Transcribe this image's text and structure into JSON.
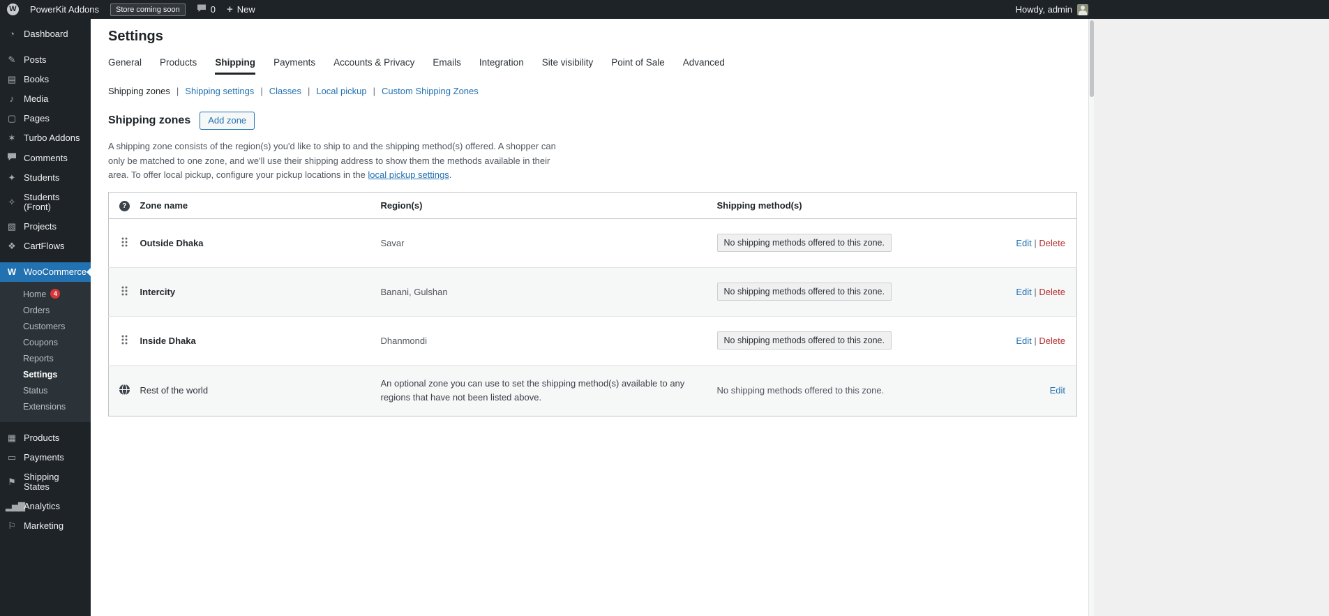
{
  "admin_bar": {
    "wp_logo_glyph": "W",
    "site_name": "PowerKit Addons",
    "coming_soon": "Store coming soon",
    "comments_count": "0",
    "new_plus": "+",
    "new_label": "New",
    "howdy": "Howdy, admin"
  },
  "sidebar": {
    "items": [
      {
        "label": "Dashboard",
        "glyph": "◔"
      },
      {
        "label": "Posts",
        "glyph": "✎"
      },
      {
        "label": "Books",
        "glyph": "▤"
      },
      {
        "label": "Media",
        "glyph": "♪"
      },
      {
        "label": "Pages",
        "glyph": "▢"
      },
      {
        "label": "Turbo Addons",
        "glyph": "✶"
      },
      {
        "label": "Comments",
        "glyph": ""
      },
      {
        "label": "Students",
        "glyph": "✦"
      },
      {
        "label": "Students (Front)",
        "glyph": "✧"
      },
      {
        "label": "Projects",
        "glyph": "▧"
      },
      {
        "label": "CartFlows",
        "glyph": "❖"
      }
    ],
    "woocommerce_label": "WooCommerce",
    "woo_glyph": "W",
    "submenu": [
      {
        "label": "Home",
        "badge": "4"
      },
      {
        "label": "Orders"
      },
      {
        "label": "Customers"
      },
      {
        "label": "Coupons"
      },
      {
        "label": "Reports"
      },
      {
        "label": "Settings"
      },
      {
        "label": "Status"
      },
      {
        "label": "Extensions"
      }
    ],
    "bottom_items": [
      {
        "label": "Products",
        "glyph": "▦"
      },
      {
        "label": "Payments",
        "glyph": "▭"
      },
      {
        "label": "Shipping States",
        "glyph": "⚑"
      },
      {
        "label": "Analytics",
        "glyph": "▂▅▇"
      },
      {
        "label": "Marketing",
        "glyph": "⚐"
      }
    ]
  },
  "page": {
    "title": "Settings",
    "tabs": [
      "General",
      "Products",
      "Shipping",
      "Payments",
      "Accounts & Privacy",
      "Emails",
      "Integration",
      "Site visibility",
      "Point of Sale",
      "Advanced"
    ],
    "active_tab": "Shipping",
    "subnav": [
      "Shipping zones",
      "Shipping settings",
      "Classes",
      "Local pickup",
      "Custom Shipping Zones"
    ],
    "subnav_separator": "|",
    "section_title": "Shipping zones",
    "add_zone_button": "Add zone",
    "description_before_link": "A shipping zone consists of the region(s) you'd like to ship to and the shipping method(s) offered. A shopper can only be matched to one zone, and we'll use their shipping address to show them the methods available in their area. To offer local pickup, configure your pickup locations in the ",
    "description_link": "local pickup settings",
    "description_after_link": "."
  },
  "table": {
    "help_icon": "?",
    "headers": [
      "Zone name",
      "Region(s)",
      "Shipping method(s)"
    ],
    "edit_label": "Edit",
    "delete_label": "Delete",
    "action_separator": "|",
    "rows": [
      {
        "zone": "Outside Dhaka",
        "regions": "Savar",
        "methods": "No shipping methods offered to this zone."
      },
      {
        "zone": "Intercity",
        "regions": "Banani, Gulshan",
        "methods": "No shipping methods offered to this zone."
      },
      {
        "zone": "Inside Dhaka",
        "regions": "Dhanmondi",
        "methods": "No shipping methods offered to this zone."
      }
    ],
    "rest_of_world": {
      "zone": "Rest of the world",
      "description": "An optional zone you can use to set the shipping method(s) available to any regions that have not been listed above.",
      "methods": "No shipping methods offered to this zone."
    }
  },
  "colors": {
    "accent": "#2271b1",
    "delete_red": "#b32d2e",
    "badge_red": "#d63638",
    "admin_bar_bg": "#1d2327",
    "content_bg": "#ffffff",
    "body_bg": "#f0f0f1"
  }
}
